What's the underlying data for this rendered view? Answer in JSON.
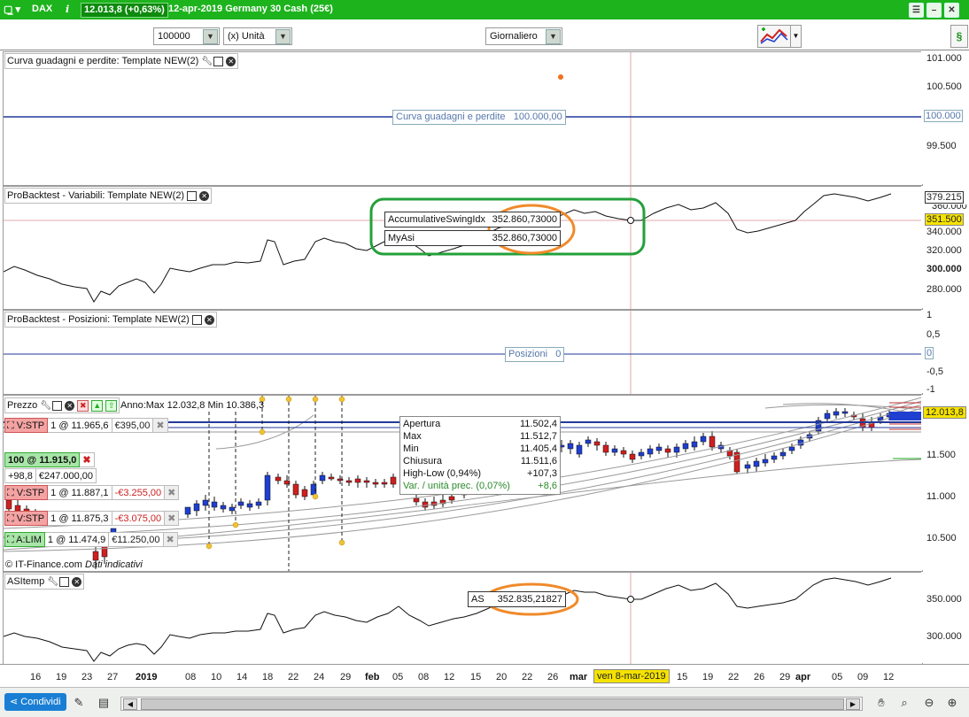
{
  "titlebar": {
    "instrument": "DAX",
    "price": "12.013,8 (+0,63%)",
    "date_name": "12-apr-2019 Germany 30 Cash (25€)"
  },
  "toolbar": {
    "quantity": "100000",
    "unit": "(x) Unità",
    "timeframe": "Giornaliero"
  },
  "panel_equity": {
    "title": "Curva guadagni e perdite: Template NEW(2)",
    "line_label": "Curva guadagni e perdite",
    "line_value": "100.000,00",
    "axis_ticks": [
      "101.000",
      "100.500",
      "99.500"
    ],
    "axis_current": "100.000"
  },
  "panel_variables": {
    "title": "ProBacktest - Variabili: Template NEW(2)",
    "label1_name": "AccumulativeSwingIdx",
    "label1_value": "352.860,73000",
    "label2_name": "MyAsi",
    "label2_value": "352.860,73000",
    "axis_top": "379.215",
    "axis_hidden": "360.000",
    "axis_current": "351.500",
    "axis_ticks": [
      "340.000",
      "320.000",
      "300.000",
      "280.000"
    ]
  },
  "panel_positions": {
    "title": "ProBacktest - Posizioni: Template NEW(2)",
    "line_label": "Posizioni",
    "line_value": "0",
    "axis_ticks": [
      "1",
      "0,5",
      "-0,5",
      "-1"
    ],
    "axis_current": "0"
  },
  "panel_price": {
    "title": "Prezzo",
    "info": "Anno:Max 12.032,8 Min 10.386,3",
    "axis_current": "12.013,8",
    "axis_ticks": [
      "11.500",
      "11.000",
      "10.500"
    ],
    "credit": "© IT-Finance.com",
    "credit_note": "Dati indicativi",
    "orders": [
      {
        "type": "V:STP",
        "qty": "1 @ 11.965,6",
        "pnl": "€395,00"
      },
      {
        "type": "V:STP",
        "qty": "1 @ 11.887,1",
        "pnl": "-€3.255,00"
      },
      {
        "type": "V:STP",
        "qty": "1 @ 11.875,3",
        "pnl": "-€3.075,00"
      },
      {
        "type": "A:LIM",
        "qty": "1 @ 11.474,9",
        "pnl": "€11.250,00"
      }
    ],
    "position": {
      "label": "100 @ 11.915,0",
      "points": "+98,8",
      "value": "€247.000,00"
    }
  },
  "data_window": {
    "rows": [
      {
        "label": "Apertura",
        "value": "11.502,4"
      },
      {
        "label": "Max",
        "value": "11.512,7"
      },
      {
        "label": "Min",
        "value": "11.405,4"
      },
      {
        "label": "Chiusura",
        "value": "11.511,6"
      },
      {
        "label": "High-Low (0,94%)",
        "value": "+107,3"
      },
      {
        "label": "Var. / unità prec. (0,07%)",
        "value": "+8,6"
      }
    ]
  },
  "panel_asi": {
    "title": "ASItemp",
    "label_name": "AS",
    "label_value": "352.835,21827",
    "axis_ticks": [
      "350.000",
      "300.000"
    ]
  },
  "xaxis": {
    "labels": [
      "16",
      "19",
      "23",
      "27",
      "2019",
      "08",
      "10",
      "14",
      "18",
      "22",
      "24",
      "29",
      "feb",
      "05",
      "08",
      "12",
      "15",
      "20",
      "22",
      "26",
      "mar",
      "ven 8-mar-2019",
      "15",
      "19",
      "22",
      "26",
      "29",
      "apr",
      "05",
      "09",
      "12"
    ]
  },
  "bottombar": {
    "share_label": "Condividi"
  },
  "colors": {
    "brand_green": "#1db31d",
    "bull_candle": "#1f3fd0",
    "bear_candle": "#d01f1f",
    "highlight_green": "#23a03a",
    "highlight_orange": "#f08a2a",
    "ref_line": "#223a9a"
  }
}
